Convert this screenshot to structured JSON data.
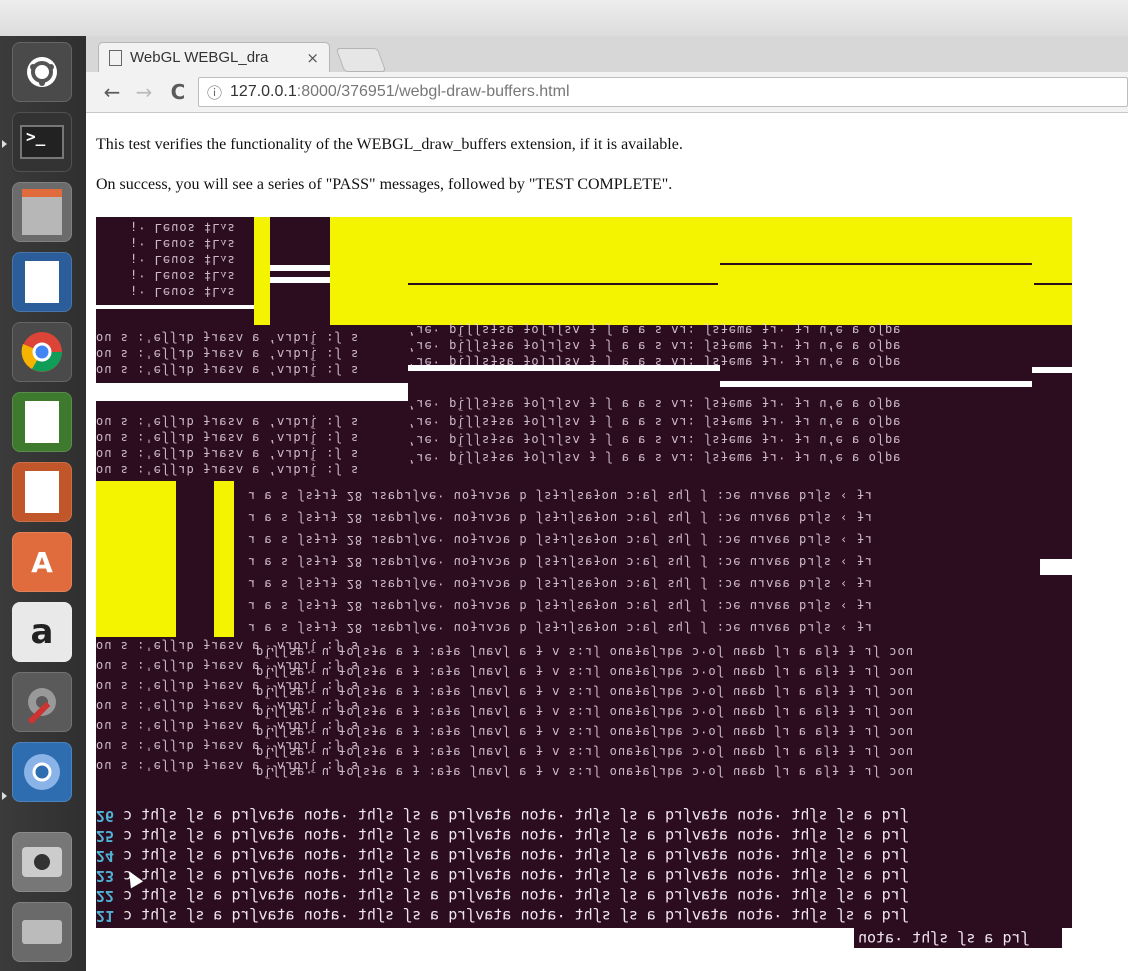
{
  "browser": {
    "tab_title": "WebGL WEBGL_dra",
    "tab_close": "×",
    "url_host": "127.0.0.1",
    "url_rest": ":8000/376951/webgl-draw-buffers.html",
    "back": "←",
    "forward": "→",
    "reload": "C",
    "info": "ⓘ"
  },
  "page": {
    "line1": "This test verifies the functionality of the WEBGL_draw_buffers extension, if it is available.",
    "line2": "On success, you will see a series of \"PASS\" messages, followed by \"TEST COMPLETE\"."
  },
  "launcher": {
    "icons": [
      "ubuntu-dash-icon",
      "terminal-icon",
      "files-icon",
      "writer-icon",
      "chrome-icon",
      "calc-icon",
      "impress-icon",
      "software-center-icon",
      "amazon-icon",
      "system-settings-icon",
      "chromium-icon",
      "camera-icon",
      "drive-icon"
    ]
  },
  "canvas_text": {
    "glyph_a": "¡· Leuos ‡Lᴧs",
    "glyph_b": "ou s :'eʃʃɹb ɟɹɐsʌ ɐ ʻʌɹbɹḹ :ʃ s",
    "glyph_c": "ʼɹe· pḹʃʃsɟsɐ ɟoʃɹʃsʌ ɟ ʃ ɐ ɐ s ʌɹ: ʃsɟeɯɐ ɟɹ· ɟɹ uʻe ɐ oʃpɐ",
    "glyph_d": "ɹ ɐ s ʃsɟɹɟ 28 ɹsɐpɹʃʌe· uoɟɹʌɔɐ b ʃsɟɹʃsɐɟou ɔ:ɐʃ sɥʃ ʃ :ɔe uɹʌɐɐ bɹʃs ‹ ɟɹ",
    "glyph_e": "pḹʃʃsɐ· u ɟoʃsɟɐ ɐ ɟ :ɐɟɐ ʃuɐʌʃ ɐ ɟ ʌ s:ɹʃ ouɐɟɐʃɹbɐ ɔ·oʃ uɐɐp ʃɹ ɐ ɐʃɟ ɟ ɹʃ ɔou",
    "term_text": "ɔ ʇɥʃs ʃs ɐ bɹʃʌɐʇɐ uoʇɐ· ʇɥʃs ʃs ɐ bɹʃʌɐʇɐ uoʇɐ· ʇɥʃs ʃs ɐ bɹʃʌɐʇɐ uoʇɐ· ʇɥʃs ʃs ɐ bɹʃ",
    "nums": [
      "26",
      "25",
      "24",
      "23",
      "22",
      "21"
    ],
    "tail": "uoʇɐ· ʇɥʃs ʃs ɐ bɹʃ"
  }
}
